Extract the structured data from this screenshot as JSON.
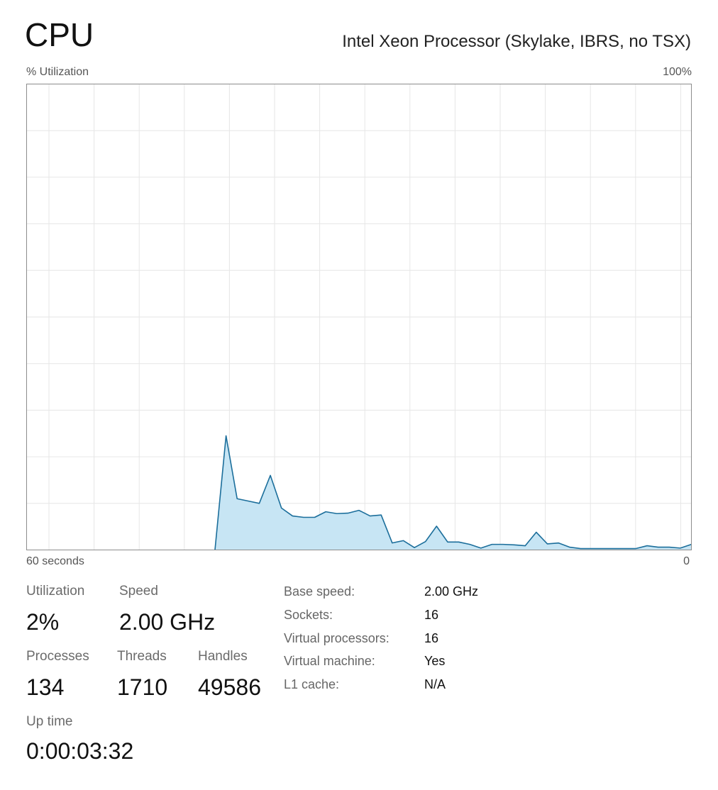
{
  "header": {
    "title": "CPU",
    "processor_name": "Intel Xeon Processor (Skylake, IBRS, no TSX)"
  },
  "graph_labels": {
    "y_label": "% Utilization",
    "y_max": "100%",
    "x_span": "60 seconds",
    "x_end": "0"
  },
  "chart_data": {
    "type": "area",
    "xlabel": "60 seconds",
    "ylabel": "% Utilization",
    "xlim": [
      60,
      0
    ],
    "ylim": [
      0,
      100
    ],
    "grid": true,
    "colors": {
      "line": "#1b6e9b",
      "fill": "#c7e5f4",
      "grid": "#e6e6e6",
      "border": "#8c8c8c"
    },
    "series": [
      {
        "x": [
          60,
          59,
          58,
          57,
          56,
          55,
          54,
          53,
          52,
          51,
          50,
          49,
          48,
          47,
          46,
          45,
          44,
          43,
          42,
          41,
          40,
          39,
          38,
          37,
          36,
          35,
          34,
          33,
          32,
          31,
          30,
          29,
          28,
          27,
          26,
          25,
          24,
          23,
          22,
          21,
          20,
          19,
          18,
          17,
          16,
          15,
          14,
          13,
          12,
          11,
          10,
          9,
          8,
          7,
          6,
          5,
          4,
          3,
          2,
          1,
          0
        ],
        "values": [
          0,
          0,
          0,
          0,
          0,
          0,
          0,
          0,
          0,
          0,
          0,
          0,
          0,
          0,
          0,
          0,
          0,
          0,
          24.5,
          11,
          10.5,
          10,
          16,
          9,
          7.3,
          7,
          7,
          8.2,
          7.8,
          7.9,
          8.5,
          7.3,
          7.5,
          1.5,
          2,
          0.5,
          1.8,
          5.1,
          1.7,
          1.7,
          1.2,
          0.4,
          1.2,
          1.2,
          1.1,
          0.9,
          3.8,
          1.3,
          1.5,
          0.6,
          0.3,
          0.3,
          0.3,
          0.3,
          0.3,
          0.3,
          0.9,
          0.6,
          0.6,
          0.4,
          1.2
        ]
      }
    ]
  },
  "stats": {
    "utilization": {
      "label": "Utilization",
      "value": "2%"
    },
    "speed": {
      "label": "Speed",
      "value": "2.00 GHz"
    },
    "processes": {
      "label": "Processes",
      "value": "134"
    },
    "threads": {
      "label": "Threads",
      "value": "1710"
    },
    "handles": {
      "label": "Handles",
      "value": "49586"
    },
    "uptime": {
      "label": "Up time",
      "value": "0:00:03:32"
    }
  },
  "info": [
    {
      "label": "Base speed:",
      "value": "2.00 GHz"
    },
    {
      "label": "Sockets:",
      "value": "16"
    },
    {
      "label": "Virtual processors:",
      "value": "16"
    },
    {
      "label": "Virtual machine:",
      "value": "Yes"
    },
    {
      "label": "L1 cache:",
      "value": "N/A"
    }
  ]
}
